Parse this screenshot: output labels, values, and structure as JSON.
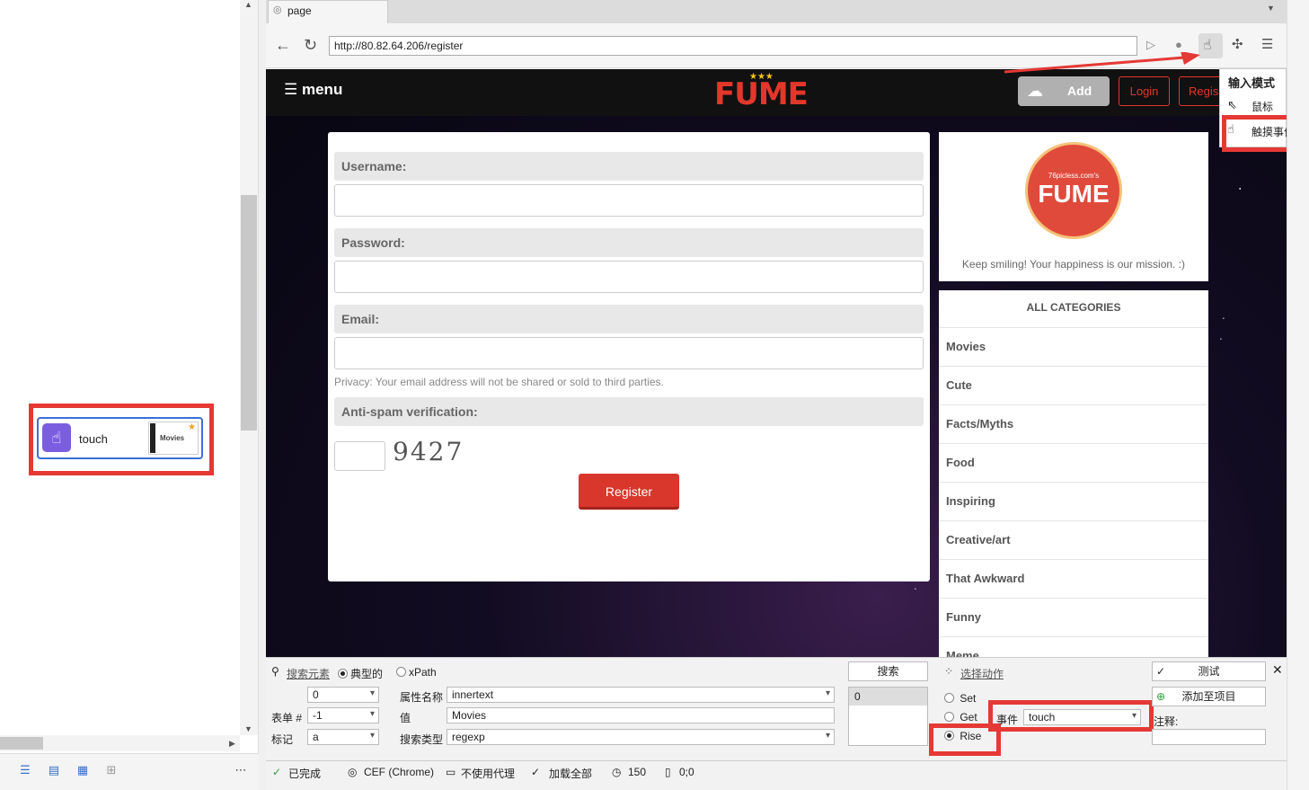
{
  "left_panel": {
    "node": {
      "label": "touch",
      "thumbnail_text": "Movies"
    }
  },
  "browser": {
    "tab_title": "page",
    "url": "http://80.82.64.206/register"
  },
  "site": {
    "menu_label": "menu",
    "logo_text": "FUME",
    "add_label": "Add",
    "login_label": "Login",
    "register_label": "Regis",
    "form": {
      "username_label": "Username:",
      "password_label": "Password:",
      "email_label": "Email:",
      "privacy_text": "Privacy: Your email address will not be shared or sold to third parties.",
      "antispam_label": "Anti-spam verification:",
      "captcha_text": "9427",
      "register_button": "Register"
    },
    "sidebar": {
      "logo_site": "76picless.com's",
      "logo_text": "FUME",
      "mission": "Keep smiling! Your happiness is our mission. :)",
      "categories_title": "ALL CATEGORIES",
      "categories": [
        "Movies",
        "Cute",
        "Facts/Myths",
        "Food",
        "Inspiring",
        "Creative/art",
        "That Awkward",
        "Funny",
        "Meme"
      ]
    }
  },
  "input_mode_menu": {
    "title": "输入模式",
    "items": [
      "鼠标",
      "触摸事件"
    ]
  },
  "bottom_panel": {
    "search_element": "搜索元素",
    "typical": "典型的",
    "xpath": "xPath",
    "index_value": "0",
    "form_label": "表单 #",
    "form_value": "-1",
    "tag_label": "标记",
    "tag_value": "a",
    "attr_name_label": "属性名称",
    "attr_name_value": "innertext",
    "value_label": "值",
    "value_value": "Movies",
    "search_type_label": "搜索类型",
    "search_type_value": "regexp",
    "search_button": "搜索",
    "result_count": "0",
    "choose_action": "选择动作",
    "action_set": "Set",
    "action_get": "Get",
    "action_rise": "Rise",
    "event_label": "事件",
    "event_value": "touch",
    "test_button": "测试",
    "add_to_project_button": "添加至项目",
    "note_label": "注释:"
  },
  "status_bar": {
    "done": "已完成",
    "engine": "CEF (Chrome)",
    "proxy": "不使用代理",
    "load_all": "加载全部",
    "timeout": "150",
    "coords": "0;0"
  }
}
